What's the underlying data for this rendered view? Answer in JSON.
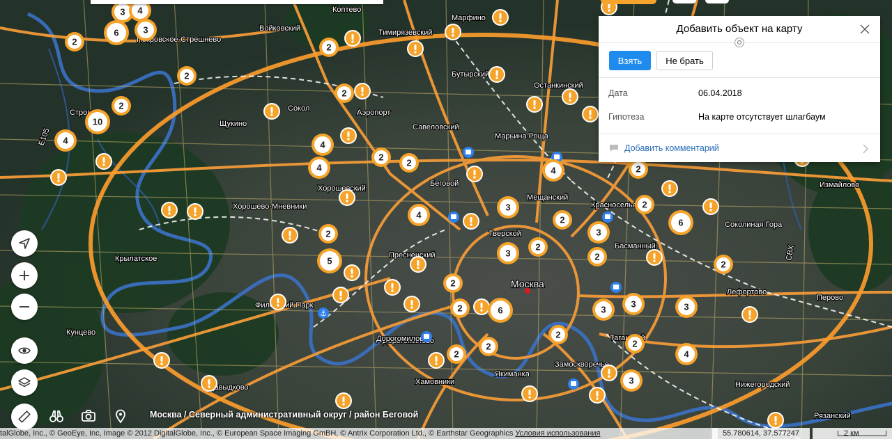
{
  "map": {
    "city_label": "Москва",
    "labels": [
      "Коптево",
      "Войковский",
      "Тимирязевский",
      "Марфино",
      "Покровское-Стрешнево",
      "Бутырский",
      "Останкинский",
      "Сокол",
      "Аэропорт",
      "Савеловский",
      "Марьина Роща",
      "Щукино",
      "Хорошевский",
      "Беговой",
      "Мещанский",
      "Хорошево-Мневники",
      "Красносельский",
      "Тверской",
      "Соколиная Гора",
      "Басманный",
      "Измайлово",
      "Крылатское",
      "Пресненский",
      "Лефортово",
      "Филевский Парк",
      "Перово",
      "Кунцево",
      "Дорогомилово",
      "Таганский",
      "Замоскворечье",
      "Хамовники",
      "Якиманка",
      "Нижегородский",
      "Рязанский",
      "Дорогомилово",
      "Строгино",
      "Давыдково"
    ],
    "road_labels": [
      "Е105",
      "СВХ"
    ],
    "cluster_counts": [
      3,
      4,
      6,
      2,
      3,
      2,
      2,
      2,
      2,
      10,
      4,
      4,
      4,
      2,
      2,
      4,
      3,
      2,
      4,
      2,
      2,
      6,
      2,
      3,
      5,
      2,
      3,
      2,
      2,
      6,
      3,
      2,
      3,
      3,
      2,
      4,
      2,
      2,
      2,
      2,
      3
    ],
    "issue_icon": "exclamation-marker-icon"
  },
  "controls": {
    "locate_icon": "locate-arrow-icon",
    "zoom_in_icon": "plus-icon",
    "zoom_out_icon": "minus-icon",
    "view_icon": "eye-icon",
    "layers_icon": "layers-icon",
    "tools": [
      "ruler-icon",
      "binoculars-icon",
      "camera-icon",
      "map-pin-icon"
    ]
  },
  "breadcrumb": "Москва / Северный административный округ / район Беговой",
  "attribution": {
    "text": "talGlobe, Inc., © GeoEye, Inc, Image © 2012 DigitalGlobe, Inc., © European Space Imaging GmBH, © Antrix Corporation Ltd., © Earthstar Geographics ",
    "terms_link": "Условия использования"
  },
  "coords": "55.780614, 37.577247",
  "scale": "2 км",
  "panel": {
    "title": "Добавить объект на карту",
    "take_label": "Взять",
    "skip_label": "Не брать",
    "date_label": "Дата",
    "date_value": "06.04.2018",
    "hypothesis_label": "Гипотеза",
    "hypothesis_value": "На карте отсутствует шлагбаум",
    "add_comment": "Добавить комментарий"
  },
  "colors": {
    "accent": "#1f8ced",
    "road": "#f29a38",
    "marker": "#f5a32a",
    "panel_bg": "#ffffff"
  }
}
